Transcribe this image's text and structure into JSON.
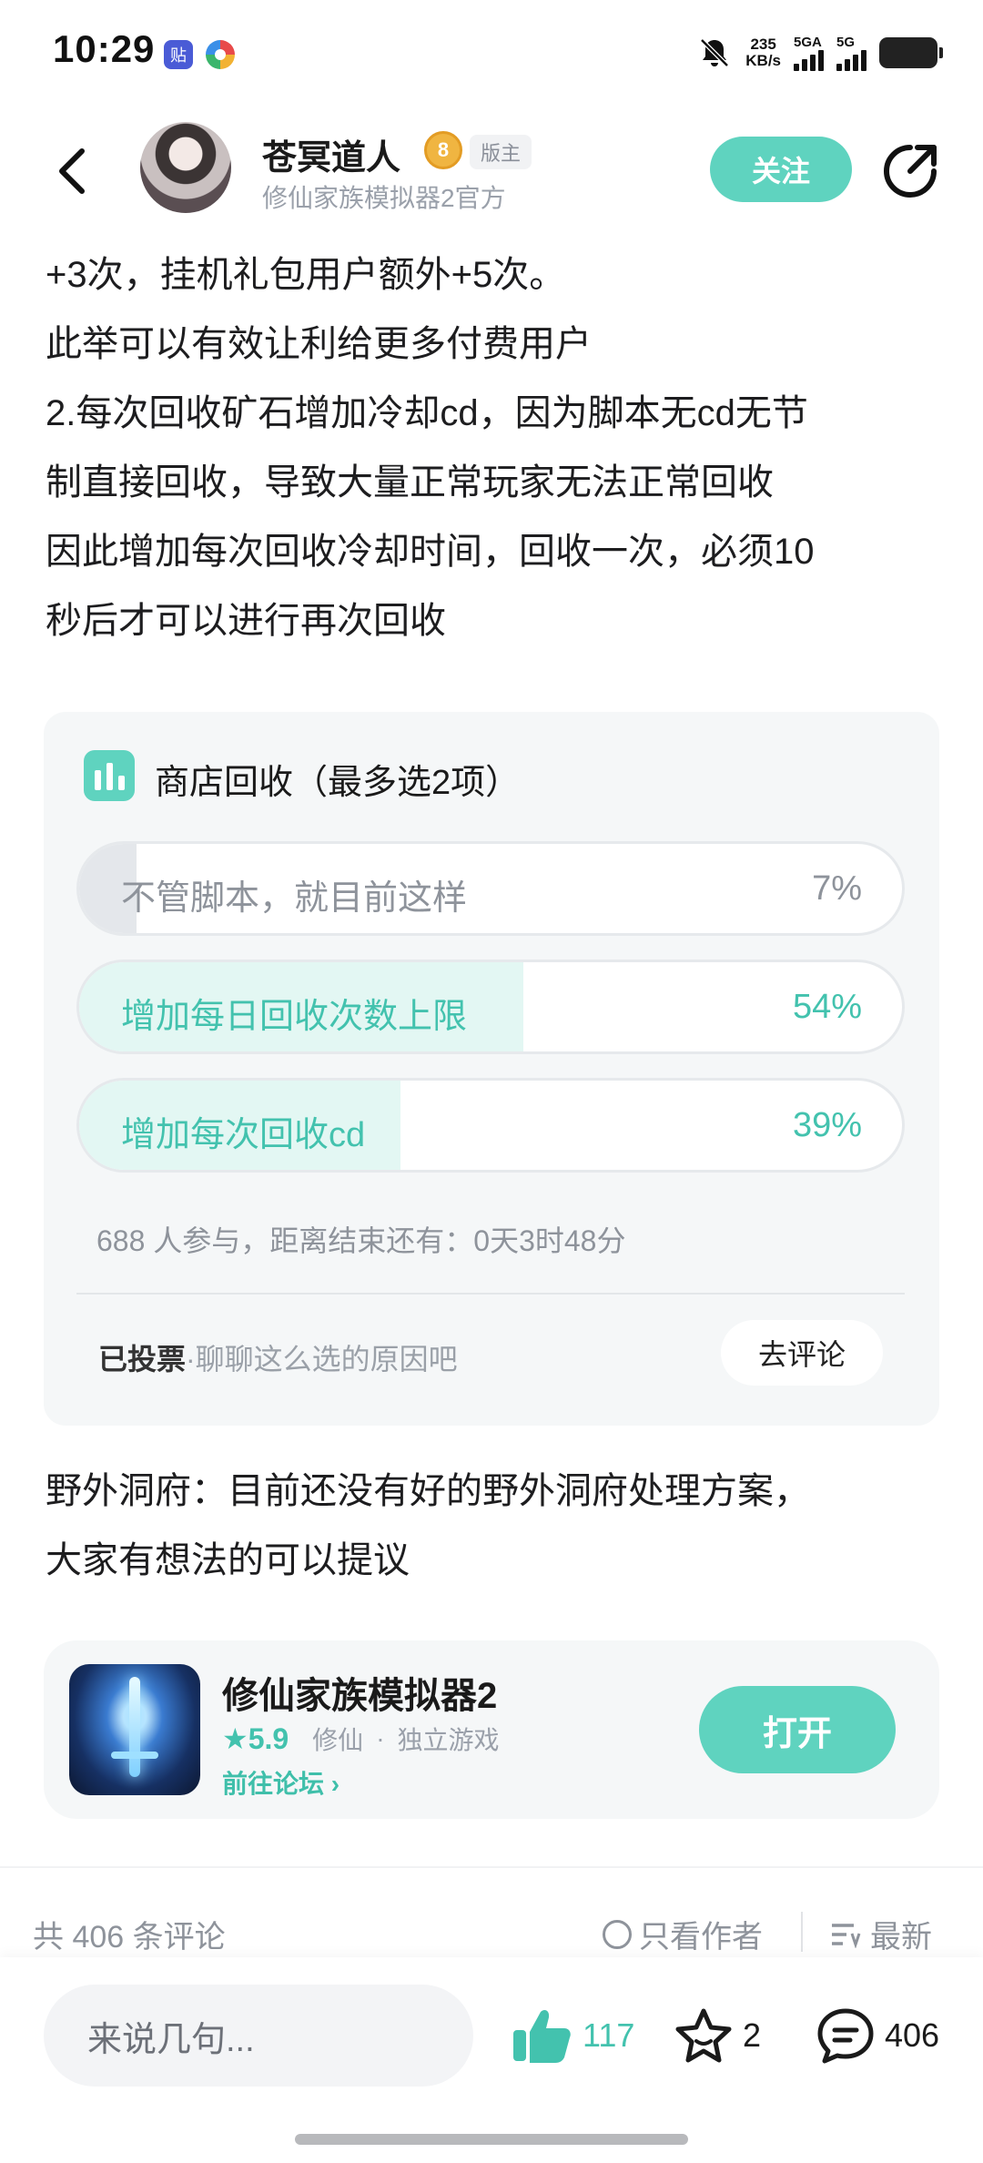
{
  "status_bar": {
    "time": "10:29",
    "app_icon_1": "贴",
    "net_speed_top": "235",
    "net_speed_bottom": "KB/s",
    "signal_1_label": "5GA",
    "signal_2_label": "5G"
  },
  "header": {
    "author_name": "苍冥道人",
    "level": "8",
    "mod_badge": "版主",
    "author_subtitle": "修仙家族模拟器2官方",
    "follow_label": "关注"
  },
  "content": {
    "lines": [
      "+3次，挂机礼包用户额外+5次。",
      "此举可以有效让利给更多付费用户",
      "2.每次回收矿石增加冷却cd，因为脚本无cd无节",
      "制直接回收，导致大量正常玩家无法正常回收",
      "因此增加每次回收冷却时间，回收一次，必须10",
      "秒后才可以进行再次回收"
    ],
    "after_vote_lines": [
      "野外洞府：目前还没有好的野外洞府处理方案，",
      "大家有想法的可以提议"
    ]
  },
  "vote": {
    "title": "商店回收（最多选2项）",
    "options": [
      {
        "label": "不管脚本，就目前这样",
        "percent_text": "7%",
        "percent": 7,
        "selected": false
      },
      {
        "label": "增加每日回收次数上限",
        "percent_text": "54%",
        "percent": 54,
        "selected": true
      },
      {
        "label": "增加每次回收cd",
        "percent_text": "39%",
        "percent": 39,
        "selected": true
      }
    ],
    "meta": "688 人参与，距离结束还有：0天3时48分",
    "voted_label": "已投票",
    "voted_hint": "·聊聊这么选的原因吧",
    "comment_button": "去评论",
    "accent_color": "#5fd3bf",
    "selected_text_color": "#43c2ae",
    "selected_fill_color": "#e3f7f3",
    "unselected_fill_color": "#e4e7eb"
  },
  "game": {
    "name": "修仙家族模拟器2",
    "rating": "5.9",
    "tag_1": "修仙",
    "tag_2": "独立游戏",
    "forum_link": "前往论坛",
    "open_label": "打开"
  },
  "comments_bar": {
    "count": "共 406 条评论",
    "only_author": "只看作者",
    "sort": "最新"
  },
  "bottom_bar": {
    "input_placeholder": "来说几句...",
    "likes": "117",
    "favorites": "2",
    "comments": "406"
  }
}
